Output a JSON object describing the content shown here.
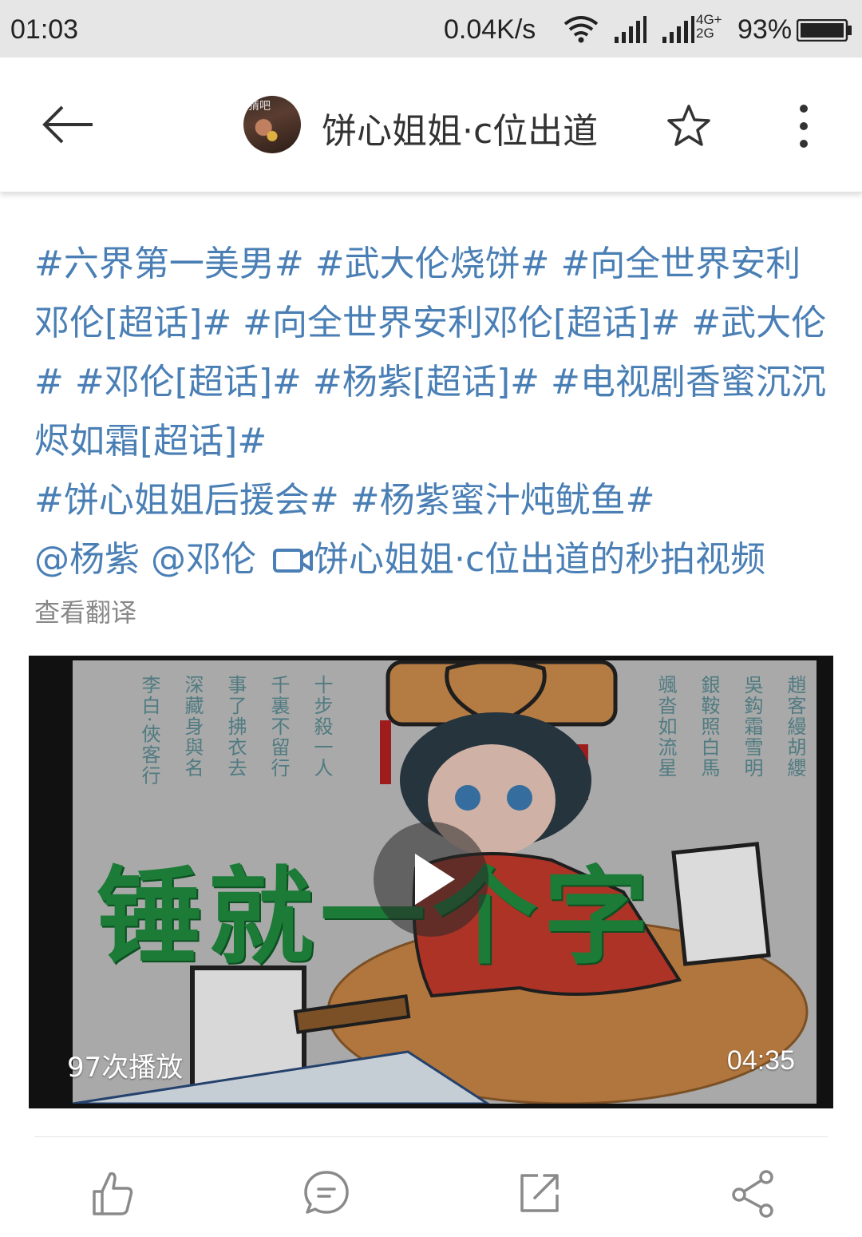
{
  "status_bar": {
    "time": "01:03",
    "speed": "0.04K/s",
    "net_top": "4G+",
    "net_bottom": "2G",
    "battery": "93%"
  },
  "header": {
    "avatar_text": "猜吧",
    "title": "饼心姐姐·c位出道"
  },
  "post": {
    "lines": [
      "#六界第一美男# #武大伦烧饼# #向全世界安利邓伦[超话]# #向全世界安利邓伦[超话]# #武大伦# #邓伦[超话]# #杨紫[超话]# #电视剧香蜜沉沉烬如霜[超话]#",
      "#饼心姐姐后援会# #杨紫蜜汁炖鱿鱼#"
    ],
    "mentions": "@杨紫 @邓伦",
    "video_link": "饼心姐姐·c位出道的秒拍视频",
    "translate": "查看翻译"
  },
  "video": {
    "poem_cols": [
      "十步殺一人",
      "千裏不留行",
      "事了拂衣去",
      "深藏身與名",
      "李白·俠客行"
    ],
    "poem_cols_right": [
      "趙客縵胡纓",
      "吳鈎霜雪明",
      "銀鞍照白馬",
      "颯沓如流星"
    ],
    "banner_text": "锤就一个字",
    "views": "97次播放",
    "duration": "04:35"
  },
  "actions": [
    {
      "name": "like-button",
      "icon": "thumb-up-icon"
    },
    {
      "name": "comment-button",
      "icon": "comment-icon"
    },
    {
      "name": "repost-button",
      "icon": "repost-icon"
    },
    {
      "name": "share-button",
      "icon": "share-icon"
    }
  ]
}
